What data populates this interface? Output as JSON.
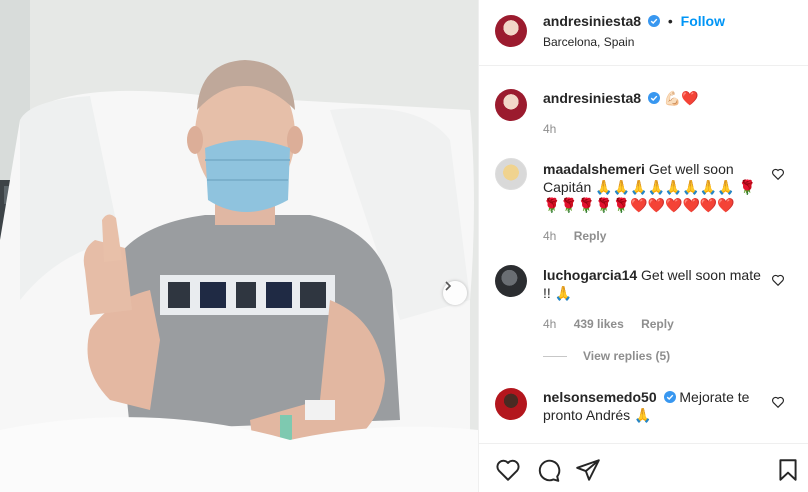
{
  "post": {
    "author": "andresiniesta8",
    "follow_label": "Follow",
    "separator": "•",
    "location": "Barcelona, Spain",
    "caption": "💪🏻❤️",
    "caption_time": "4h"
  },
  "comments": [
    {
      "username": "maadalshemeri",
      "text": "Get well soon Capitán 🙏🙏🙏🙏🙏🙏🙏🙏 🌹🌹🌹🌹🌹🌹❤️❤️❤️❤️❤️❤️",
      "time": "4h",
      "reply": "Reply"
    },
    {
      "username": "luchogarcia14",
      "text": "Get well soon mate !! 🙏",
      "time": "4h",
      "likes": "439 likes",
      "reply": "Reply",
      "view_replies": "View replies (5)"
    },
    {
      "username": "nelsonsemedo50",
      "text": "Mejorate te pronto Andrés 🙏"
    }
  ],
  "icons": {
    "carousel": "chevron-right-icon",
    "like": "heart-icon",
    "comment": "comment-icon",
    "share": "paper-plane-icon",
    "save": "bookmark-icon",
    "verified": "verified-badge-icon"
  },
  "colors": {
    "accent": "#0095f6",
    "muted": "#8e8e8e",
    "text": "#262626",
    "verified": "#3897f0"
  }
}
